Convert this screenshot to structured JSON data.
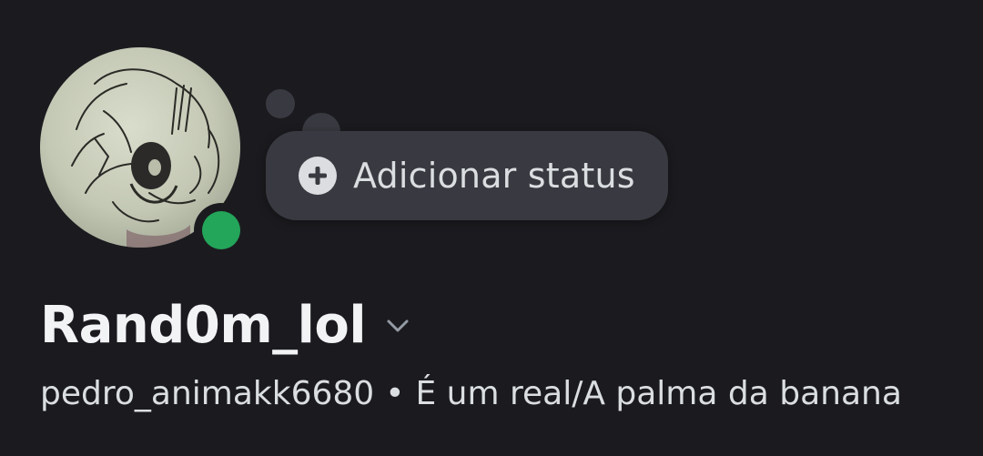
{
  "profile": {
    "display_name": "Rand0m_lol",
    "username": "pedro_animakk6680",
    "separator": "•",
    "pronouns_bio": "É um real/A palma da banana",
    "status_indicator": "online",
    "status_color": "#23a55a"
  },
  "custom_status": {
    "label": "Adicionar status",
    "icon": "plus-circle-icon"
  },
  "icons": {
    "display_name_chevron": "chevron-down-icon"
  },
  "colors": {
    "background": "#1b1b1f",
    "bubble": "#393a41",
    "text_primary": "#f2f3f5",
    "text_secondary": "#dbdee1"
  }
}
